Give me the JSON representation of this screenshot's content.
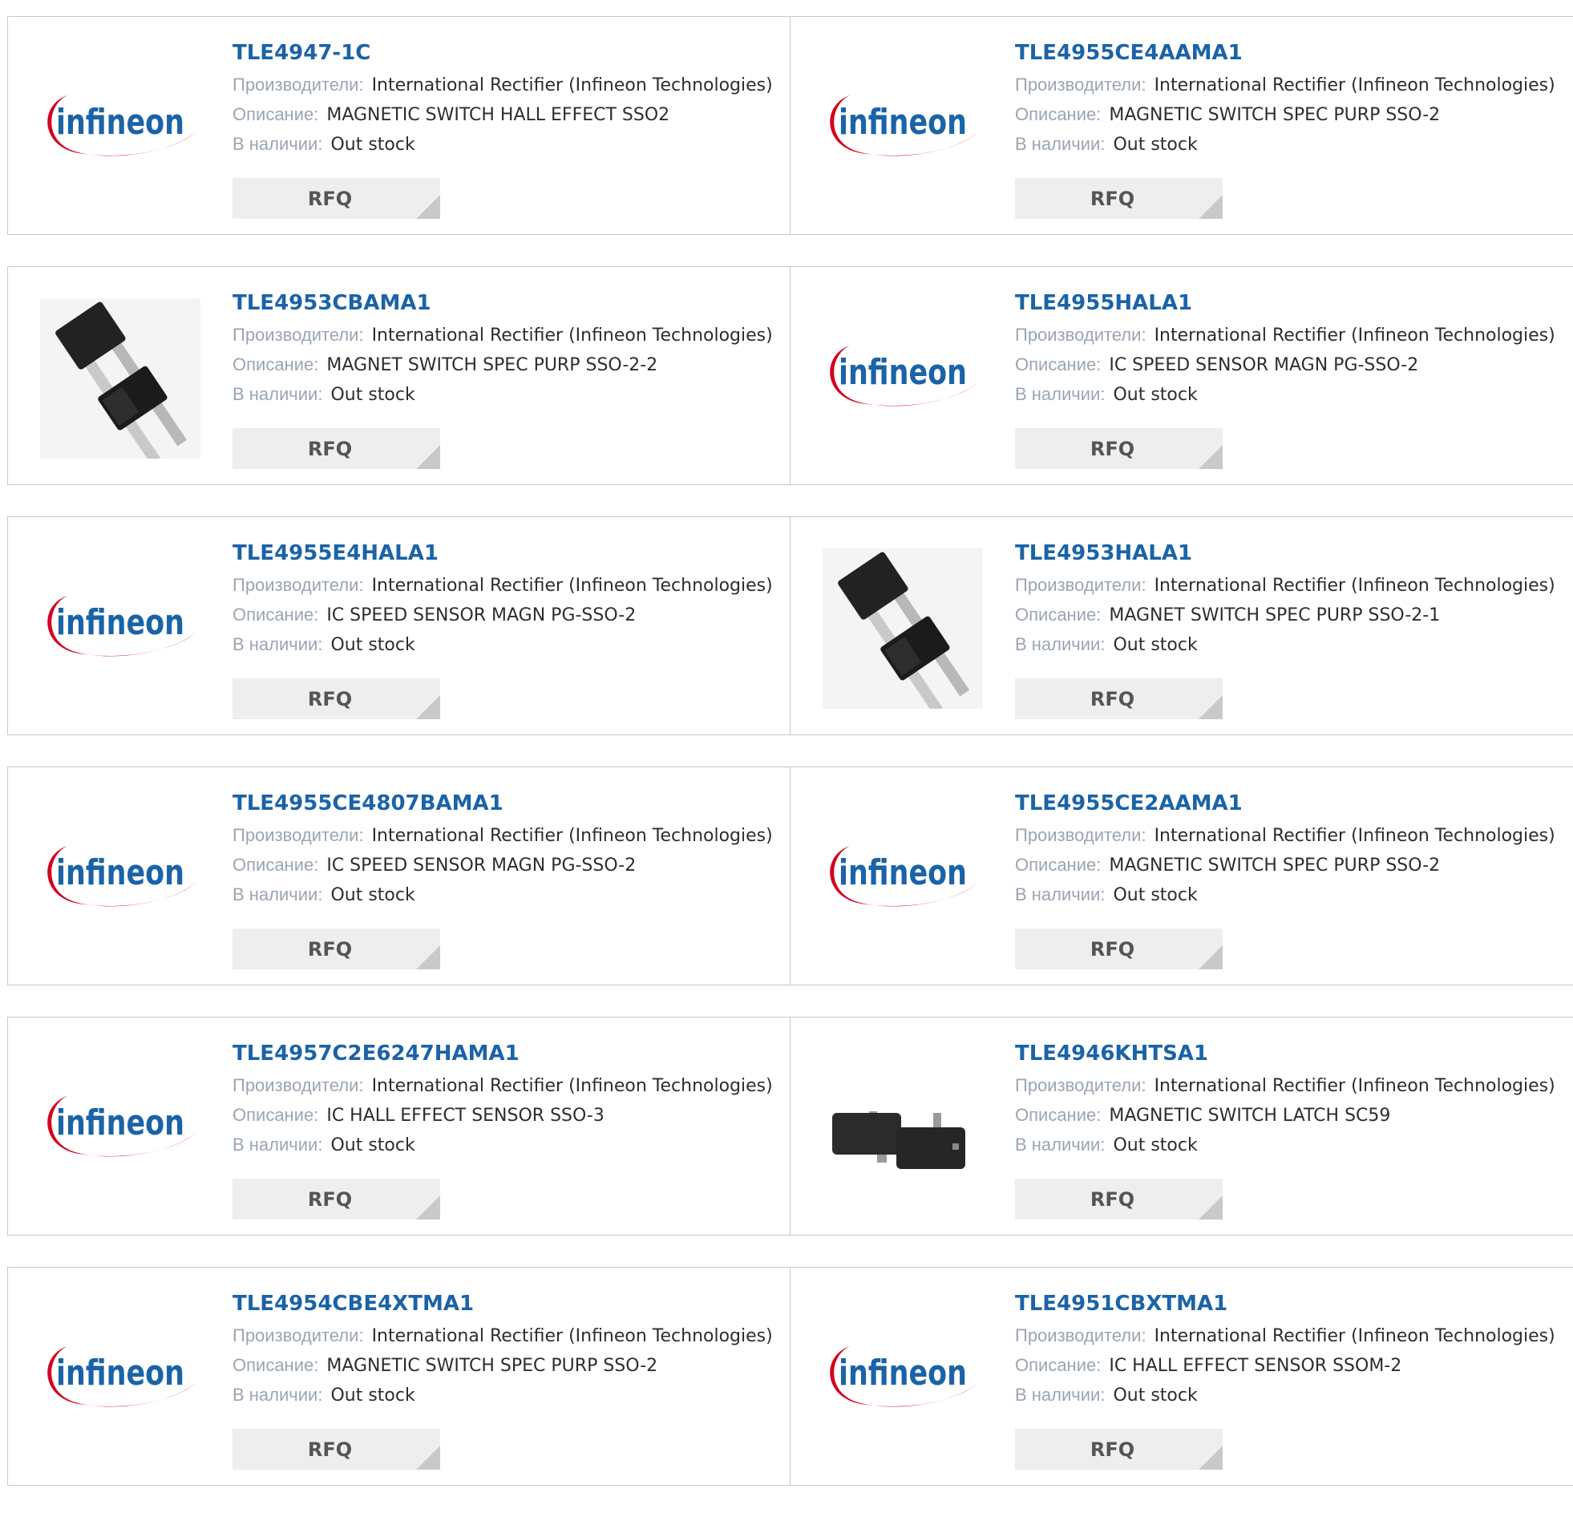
{
  "labels": {
    "manufacturer": "Производители:",
    "description": "Описание:",
    "stock": "В наличии:",
    "rfq": "RFQ"
  },
  "colors": {
    "link": "#1a63a8",
    "infineon_blue": "#1a63a8",
    "infineon_red": "#d4001f"
  },
  "products": [
    {
      "pn": "TLE4947-1C",
      "manufacturer": "International Rectifier (Infineon Technologies)",
      "description": "MAGNETIC SWITCH HALL EFFECT SSO2",
      "stock": "Out stock",
      "image": "infineon-logo"
    },
    {
      "pn": "TLE4955CE4AAMA1",
      "manufacturer": "International Rectifier (Infineon Technologies)",
      "description": "MAGNETIC SWITCH SPEC PURP SSO-2",
      "stock": "Out stock",
      "image": "infineon-logo"
    },
    {
      "pn": "TLE4953CBAMA1",
      "manufacturer": "International Rectifier (Infineon Technologies)",
      "description": "MAGNET SWITCH SPEC PURP SSO-2-2",
      "stock": "Out stock",
      "image": "sensor-photo"
    },
    {
      "pn": "TLE4955HALA1",
      "manufacturer": "International Rectifier (Infineon Technologies)",
      "description": "IC SPEED SENSOR MAGN PG-SSO-2",
      "stock": "Out stock",
      "image": "infineon-logo"
    },
    {
      "pn": "TLE4955E4HALA1",
      "manufacturer": "International Rectifier (Infineon Technologies)",
      "description": "IC SPEED SENSOR MAGN PG-SSO-2",
      "stock": "Out stock",
      "image": "infineon-logo"
    },
    {
      "pn": "TLE4953HALA1",
      "manufacturer": "International Rectifier (Infineon Technologies)",
      "description": "MAGNET SWITCH SPEC PURP SSO-2-1",
      "stock": "Out stock",
      "image": "sensor-photo"
    },
    {
      "pn": "TLE4955CE4807BAMA1",
      "manufacturer": "International Rectifier (Infineon Technologies)",
      "description": "IC SPEED SENSOR MAGN PG-SSO-2",
      "stock": "Out stock",
      "image": "infineon-logo"
    },
    {
      "pn": "TLE4955CE2AAMA1",
      "manufacturer": "International Rectifier (Infineon Technologies)",
      "description": "MAGNETIC SWITCH SPEC PURP SSO-2",
      "stock": "Out stock",
      "image": "infineon-logo"
    },
    {
      "pn": "TLE4957C2E6247HAMA1",
      "manufacturer": "International Rectifier (Infineon Technologies)",
      "description": "IC HALL EFFECT SENSOR SSO-3",
      "stock": "Out stock",
      "image": "infineon-logo"
    },
    {
      "pn": "TLE4946KHTSA1",
      "manufacturer": "International Rectifier (Infineon Technologies)",
      "description": "MAGNETIC SWITCH LATCH SC59",
      "stock": "Out stock",
      "image": "sc59-chip-photo"
    },
    {
      "pn": "TLE4954CBE4XTMA1",
      "manufacturer": "International Rectifier (Infineon Technologies)",
      "description": "MAGNETIC SWITCH SPEC PURP SSO-2",
      "stock": "Out stock",
      "image": "infineon-logo"
    },
    {
      "pn": "TLE4951CBXTMA1",
      "manufacturer": "International Rectifier (Infineon Technologies)",
      "description": "IC HALL EFFECT SENSOR SSOM-2",
      "stock": "Out stock",
      "image": "infineon-logo"
    }
  ]
}
